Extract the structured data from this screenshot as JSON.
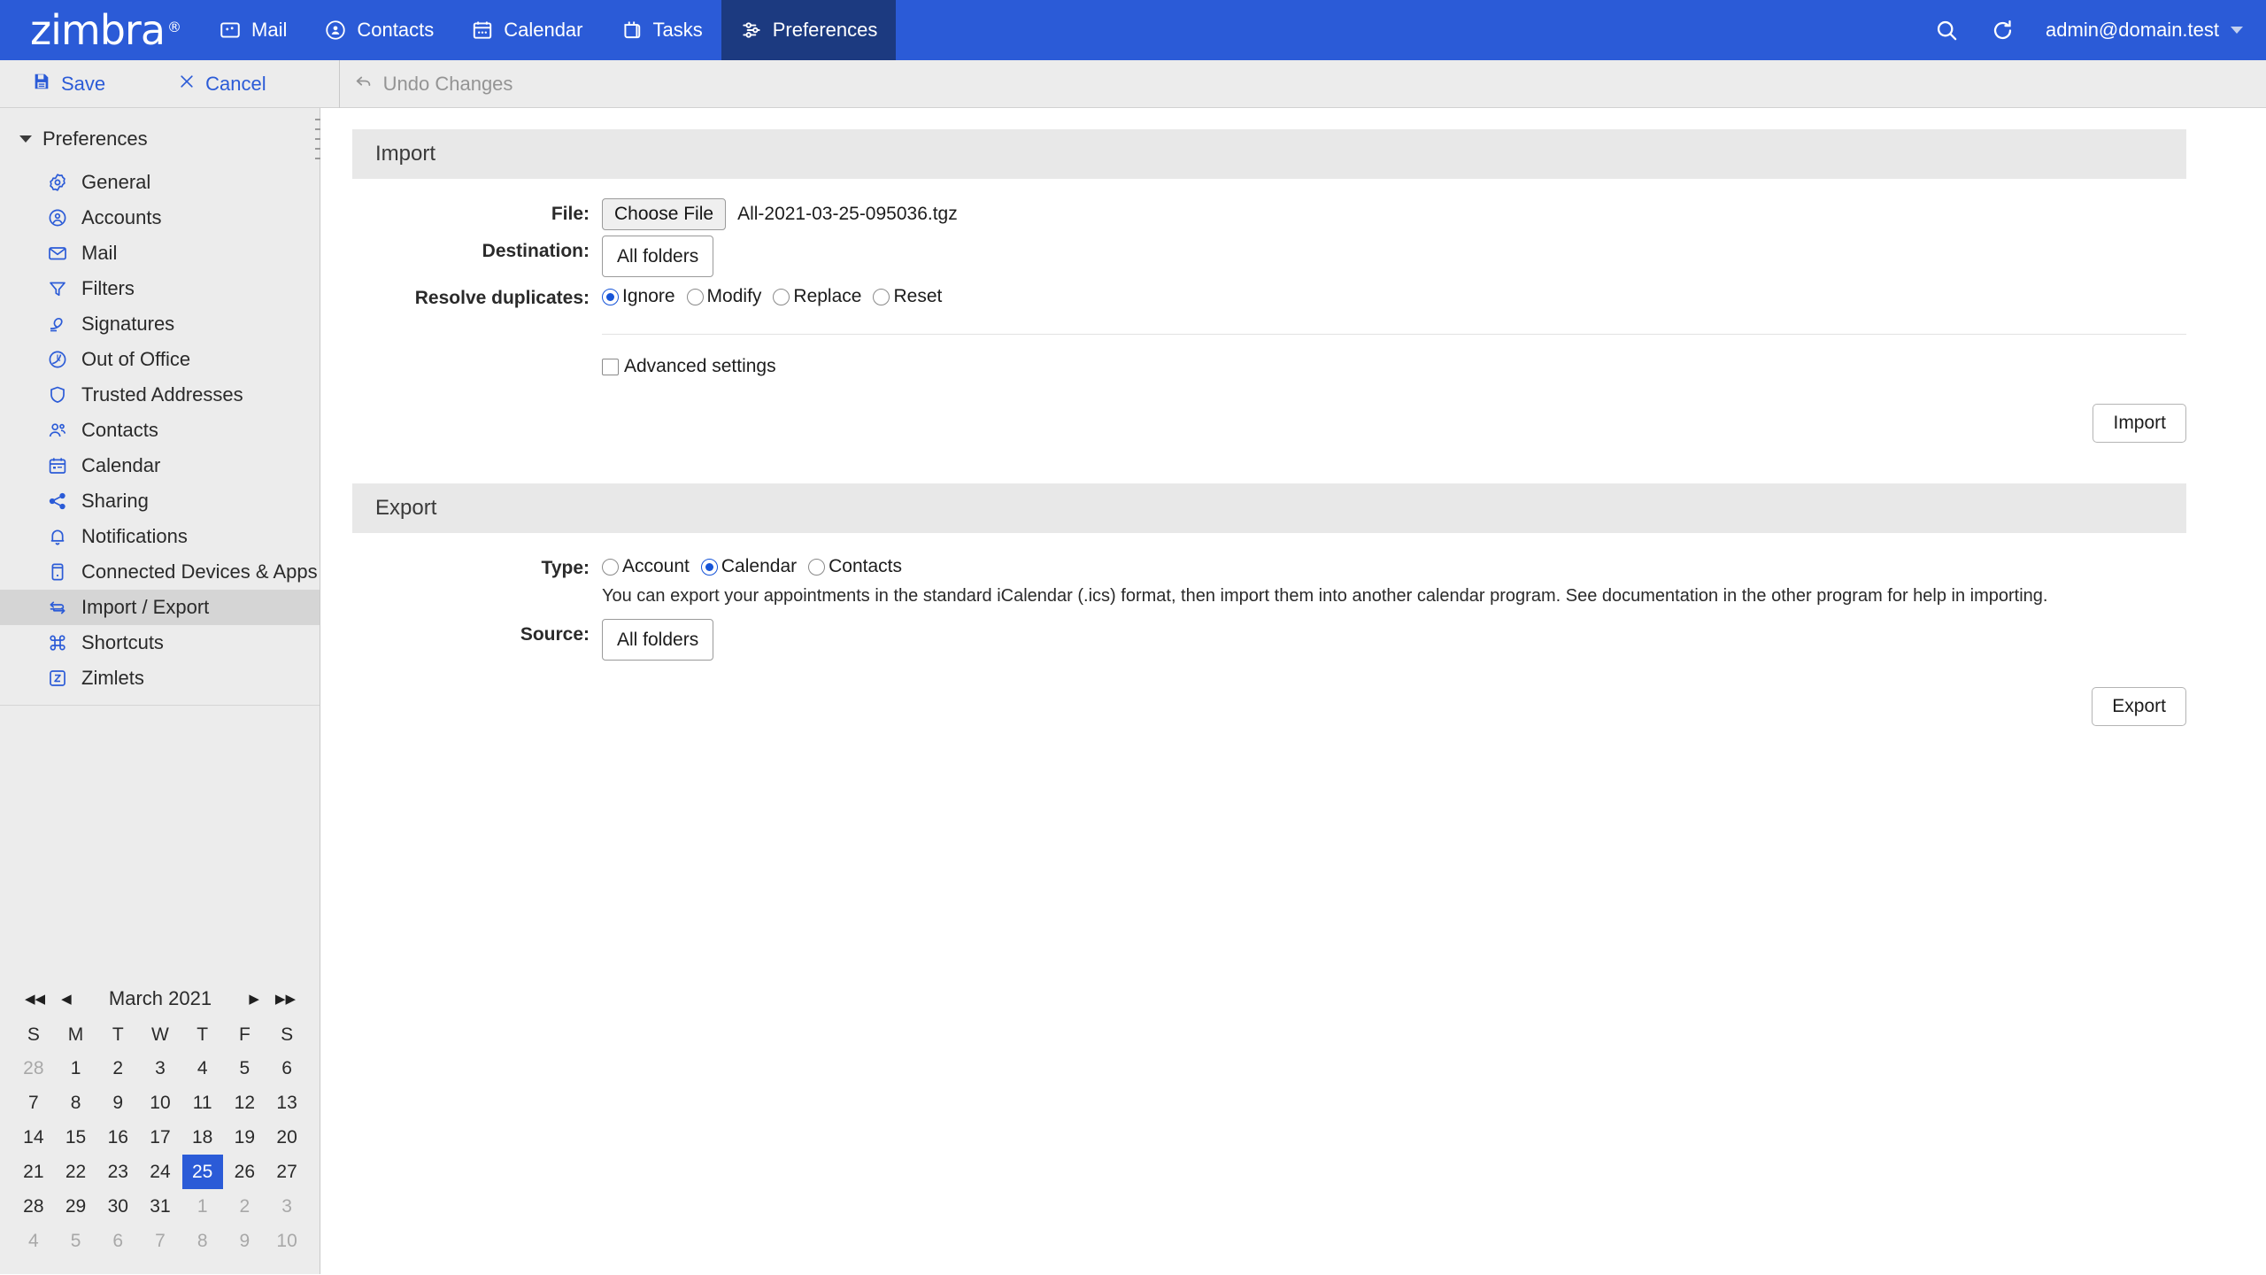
{
  "header": {
    "brand": "zimbra",
    "brand_mark": "®",
    "tabs": [
      {
        "label": "Mail",
        "icon": "mail-icon",
        "active": false
      },
      {
        "label": "Contacts",
        "icon": "contacts-icon",
        "active": false
      },
      {
        "label": "Calendar",
        "icon": "calendar-icon",
        "active": false
      },
      {
        "label": "Tasks",
        "icon": "tasks-icon",
        "active": false
      },
      {
        "label": "Preferences",
        "icon": "preferences-icon",
        "active": true
      }
    ],
    "search_icon": "search-icon",
    "refresh_icon": "refresh-icon",
    "account": "admin@domain.test",
    "accent_color": "#2b5bd7",
    "active_tab_color": "#1c3a80"
  },
  "toolbar": {
    "save_label": "Save",
    "cancel_label": "Cancel",
    "undo_label": "Undo Changes",
    "link_color": "#2b5bd7",
    "disabled_color": "#949494"
  },
  "sidebar": {
    "root_label": "Preferences",
    "items": [
      {
        "label": "General",
        "icon": "gear-icon"
      },
      {
        "label": "Accounts",
        "icon": "account-circle-icon"
      },
      {
        "label": "Mail",
        "icon": "envelope-icon"
      },
      {
        "label": "Filters",
        "icon": "funnel-icon"
      },
      {
        "label": "Signatures",
        "icon": "pen-icon"
      },
      {
        "label": "Out of Office",
        "icon": "clock-icon"
      },
      {
        "label": "Trusted Addresses",
        "icon": "shield-icon"
      },
      {
        "label": "Contacts",
        "icon": "people-icon"
      },
      {
        "label": "Calendar",
        "icon": "calendar-icon"
      },
      {
        "label": "Sharing",
        "icon": "share-icon"
      },
      {
        "label": "Notifications",
        "icon": "bell-icon"
      },
      {
        "label": "Connected Devices & Apps",
        "icon": "device-icon"
      },
      {
        "label": "Import / Export",
        "icon": "import-export-icon"
      },
      {
        "label": "Shortcuts",
        "icon": "command-icon"
      },
      {
        "label": "Zimlets",
        "icon": "zimlet-icon"
      }
    ],
    "selected_index": 12,
    "selected_color": "#d5d5d5"
  },
  "minicalendar": {
    "title": "March 2021",
    "nav": {
      "first": "◀◀",
      "prev": "◀",
      "next": "▶",
      "last": "▶▶"
    },
    "weekdays": [
      "S",
      "M",
      "T",
      "W",
      "T",
      "F",
      "S"
    ],
    "weeks": [
      [
        {
          "d": "28",
          "muted": true
        },
        {
          "d": "1"
        },
        {
          "d": "2"
        },
        {
          "d": "3"
        },
        {
          "d": "4"
        },
        {
          "d": "5"
        },
        {
          "d": "6"
        }
      ],
      [
        {
          "d": "7"
        },
        {
          "d": "8"
        },
        {
          "d": "9"
        },
        {
          "d": "10"
        },
        {
          "d": "11"
        },
        {
          "d": "12"
        },
        {
          "d": "13"
        }
      ],
      [
        {
          "d": "14"
        },
        {
          "d": "15"
        },
        {
          "d": "16"
        },
        {
          "d": "17"
        },
        {
          "d": "18"
        },
        {
          "d": "19"
        },
        {
          "d": "20"
        }
      ],
      [
        {
          "d": "21"
        },
        {
          "d": "22"
        },
        {
          "d": "23"
        },
        {
          "d": "24"
        },
        {
          "d": "25",
          "today": true
        },
        {
          "d": "26"
        },
        {
          "d": "27"
        }
      ],
      [
        {
          "d": "28"
        },
        {
          "d": "29"
        },
        {
          "d": "30"
        },
        {
          "d": "31"
        },
        {
          "d": "1",
          "muted": true
        },
        {
          "d": "2",
          "muted": true
        },
        {
          "d": "3",
          "muted": true
        }
      ],
      [
        {
          "d": "4",
          "muted": true
        },
        {
          "d": "5",
          "muted": true
        },
        {
          "d": "6",
          "muted": true
        },
        {
          "d": "7",
          "muted": true
        },
        {
          "d": "8",
          "muted": true
        },
        {
          "d": "9",
          "muted": true
        },
        {
          "d": "10",
          "muted": true
        }
      ]
    ],
    "today_color": "#2b5bd7"
  },
  "import": {
    "title": "Import",
    "file_label": "File:",
    "choose_file_label": "Choose File",
    "file_name": "All-2021-03-25-095036.tgz",
    "destination_label": "Destination:",
    "destination_value": "All folders",
    "resolve_label": "Resolve duplicates:",
    "resolve_options": [
      {
        "label": "Ignore",
        "checked": true
      },
      {
        "label": "Modify",
        "checked": false
      },
      {
        "label": "Replace",
        "checked": false
      },
      {
        "label": "Reset",
        "checked": false
      }
    ],
    "advanced_label": "Advanced settings",
    "advanced_checked": false,
    "button_label": "Import"
  },
  "export": {
    "title": "Export",
    "type_label": "Type:",
    "type_options": [
      {
        "label": "Account",
        "checked": false
      },
      {
        "label": "Calendar",
        "checked": true
      },
      {
        "label": "Contacts",
        "checked": false
      }
    ],
    "help_text": "You can export your appointments in the standard iCalendar (.ics) format, then import them into another calendar program. See documentation in the other program for help in importing.",
    "source_label": "Source:",
    "source_value": "All folders",
    "button_label": "Export"
  }
}
